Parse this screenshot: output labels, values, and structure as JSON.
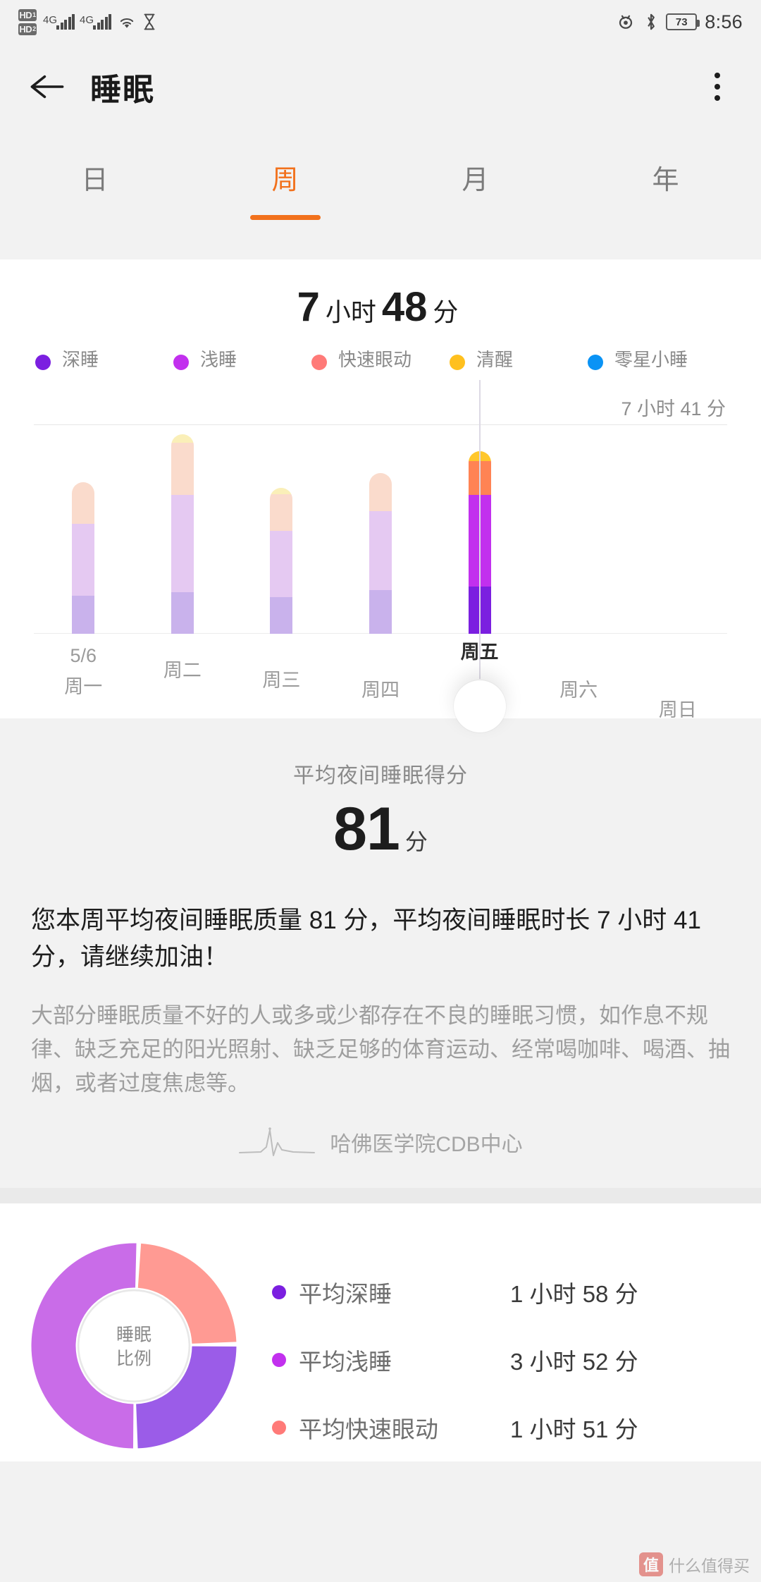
{
  "status_bar": {
    "hd1_label": "HD",
    "hd1_sub": "1",
    "hd2_label": "HD",
    "hd2_sub": "2",
    "net1_label": "4G",
    "net2_label": "4G",
    "wifi_icon": "wifi-icon",
    "hourglass_icon": "hourglass-icon",
    "eye_off_icon": "eye-off-icon",
    "bluetooth_icon": "bluetooth-icon",
    "battery_level": "73",
    "time": "8:56"
  },
  "app_bar": {
    "back_icon": "back-arrow-icon",
    "title": "睡眠",
    "menu_icon": "overflow-menu-icon"
  },
  "tabs": [
    {
      "label": "日",
      "active": false
    },
    {
      "label": "周",
      "active": true
    },
    {
      "label": "月",
      "active": false
    },
    {
      "label": "年",
      "active": false
    }
  ],
  "summary": {
    "hours": "7",
    "hours_unit": "小时",
    "minutes": "48",
    "minutes_unit": "分"
  },
  "legend": [
    {
      "label": "深睡",
      "color": "#7B1FE0"
    },
    {
      "label": "浅睡",
      "color": "#C230EE"
    },
    {
      "label": "快速眼动",
      "color": "#FF7A78"
    },
    {
      "label": "清醒",
      "color": "#FFC01E"
    },
    {
      "label": "零星小睡",
      "color": "#0A93F5"
    }
  ],
  "chart_data": {
    "type": "bar",
    "title": "每周睡眠时长",
    "stacked": true,
    "xlabel": "",
    "ylabel": "",
    "grid": false,
    "average_line_label": "7 小时 41 分",
    "average_line_minutes": 461,
    "week_start_date": "5/6",
    "selected_category": "周五",
    "categories": [
      "周一",
      "周二",
      "周三",
      "周四",
      "周五",
      "周六",
      "周日"
    ],
    "series": [
      {
        "name": "深睡",
        "color": "#7B1FE0",
        "muted": "#C9B2EC",
        "values": [
          96,
          104,
          92,
          110,
          118,
          0,
          0
        ]
      },
      {
        "name": "浅睡",
        "color": "#C230EE",
        "muted": "#E5C9F2",
        "values": [
          181,
          246,
          168,
          200,
          232,
          0,
          0
        ]
      },
      {
        "name": "快速眼动",
        "color": "#FF8354",
        "muted": "#FADBCC",
        "values": [
          105,
          132,
          92,
          96,
          86,
          0,
          0
        ]
      },
      {
        "name": "清醒",
        "color": "#FFC72C",
        "muted": "#FAEFB8",
        "values": [
          0,
          22,
          16,
          0,
          25,
          0,
          0
        ]
      }
    ],
    "ylim": [
      0,
      520
    ]
  },
  "score": {
    "label": "平均夜间睡眠得分",
    "value": "81",
    "unit": "分"
  },
  "advice": {
    "main": "您本周平均夜间睡眠质量 81 分，平均夜间睡眠时长 7 小时 41 分，请继续加油！",
    "sub": "大部分睡眠质量不好的人或多或少都存在不良的睡眠习惯，如作息不规律、缺乏充足的阳光照射、缺乏足够的体育运动、经常喝咖啡、喝酒、抽烟，或者过度焦虑等。",
    "source_icon": "heartbeat-icon",
    "source": "哈佛医学院CDB中心"
  },
  "ratio": {
    "donut_title_line1": "睡眠",
    "donut_title_line2": "比例",
    "donut": {
      "type": "pie",
      "segments": [
        {
          "name": "平均快速眼动",
          "color": "#FF9A93",
          "percent": 24
        },
        {
          "name": "平均深睡",
          "color": "#9B5CE8",
          "percent": 25
        },
        {
          "name": "平均浅睡",
          "color": "#C96CE8",
          "percent": 51
        }
      ]
    },
    "rows": [
      {
        "label": "平均深睡",
        "value": "1 小时 58 分",
        "color": "#7B1FE0"
      },
      {
        "label": "平均浅睡",
        "value": "3 小时 52 分",
        "color": "#C230EE"
      },
      {
        "label": "平均快速眼动",
        "value": "1 小时 51 分",
        "color": "#FF7A78"
      }
    ]
  },
  "watermark": {
    "badge": "值",
    "text": "什么值得买"
  }
}
